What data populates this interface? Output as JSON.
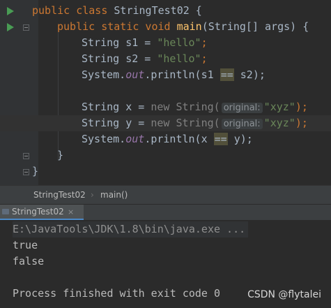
{
  "editor": {
    "lines": [
      {
        "kw": "public class ",
        "name": "StringTest02",
        "rest": " {"
      },
      {
        "kw": "public static void ",
        "fn": "main",
        "rest": "(String[] args) {"
      },
      {
        "a": "String s1 = ",
        "s": "\"hello\"",
        "b": ";"
      },
      {
        "a": "String s2 = ",
        "s": "\"hello\"",
        "b": ";"
      },
      {
        "a": "System.",
        "f": "out",
        "b": ".println(s1 ",
        "op": "==",
        "c": " s2);"
      },
      {
        "a": "String x = ",
        "n": "new",
        "c1": " String(",
        "hint": "original:",
        "s": "\"xyz\"",
        "b": ");"
      },
      {
        "a": "String y = ",
        "n": "new",
        "c1": " String(",
        "hint": "original:",
        "s": "\"xyz\"",
        "b": ");"
      },
      {
        "a": "System.",
        "f": "out",
        "b": ".println(x ",
        "op": "==",
        "c": " y);"
      },
      {
        "t": "}"
      },
      {
        "t": "}"
      }
    ]
  },
  "breadcrumb": {
    "class_name": "StringTest02",
    "separator": "›",
    "method": "main()"
  },
  "run": {
    "tab_label": "StringTest02",
    "close_glyph": "×"
  },
  "console": {
    "command": "E:\\JavaTools\\JDK\\1.8\\bin\\java.exe ...",
    "out1": "true",
    "out2": "false",
    "finish": "Process finished with exit code 0"
  },
  "watermark": "CSDN @flytalei",
  "colors": {
    "run_arrow": "#499c54",
    "keyword": "#cc7832",
    "string": "#6a8759",
    "method": "#ffc66d",
    "field": "#9876aa"
  }
}
